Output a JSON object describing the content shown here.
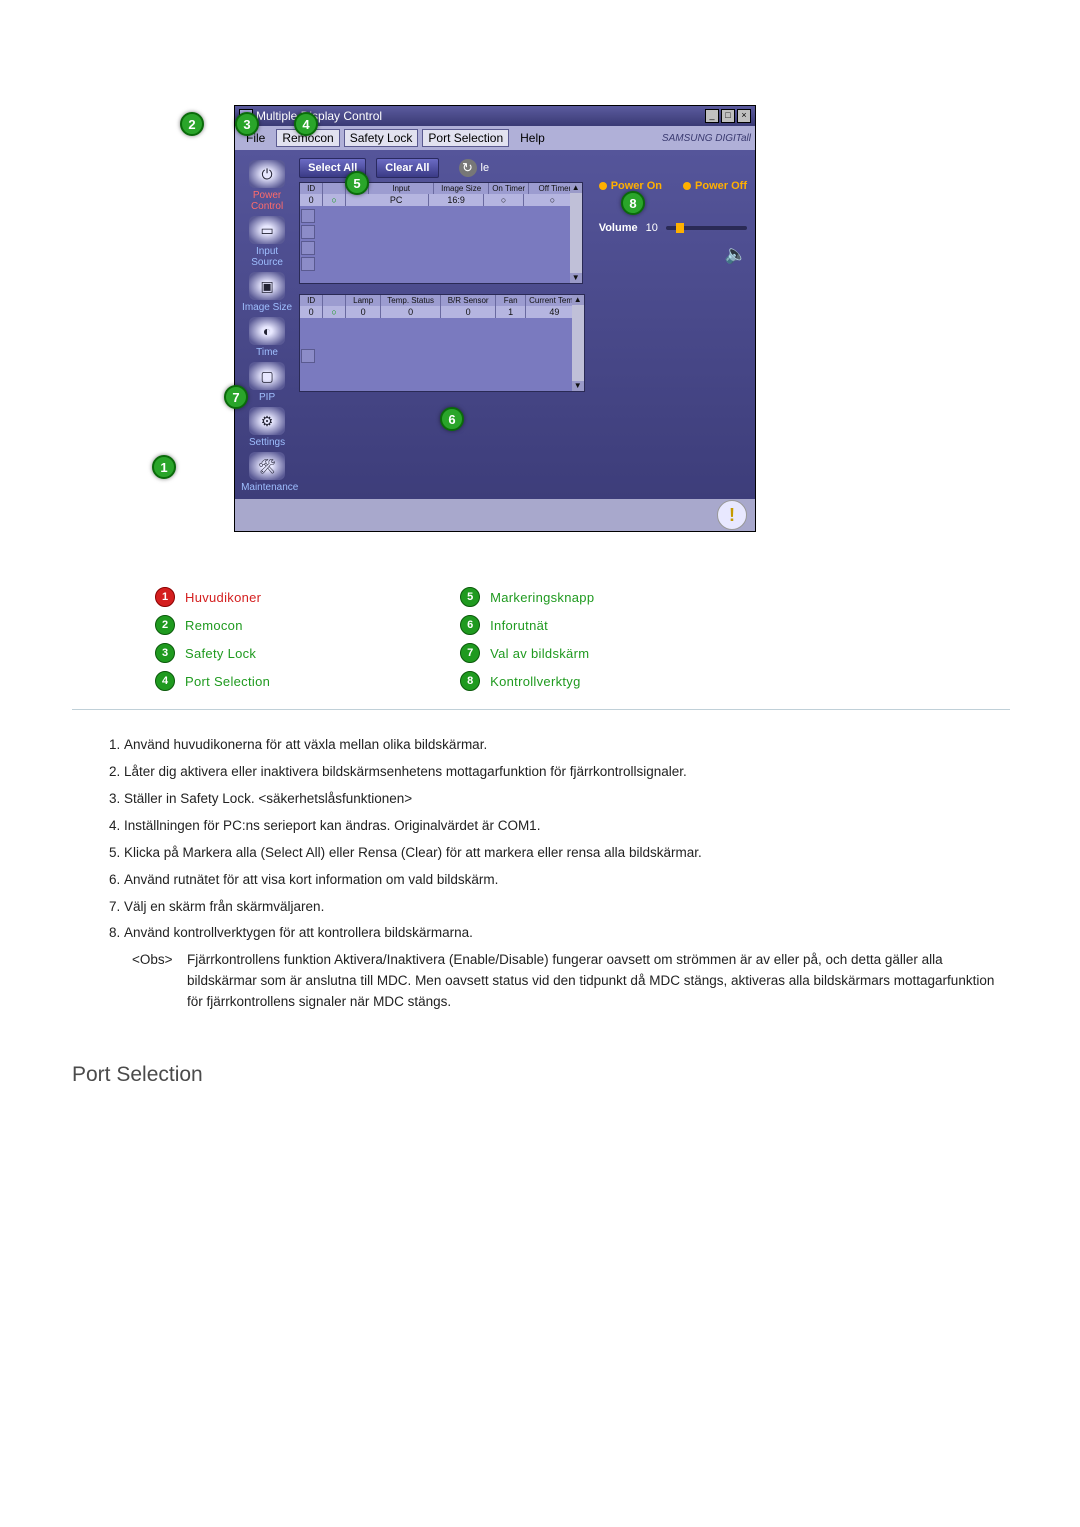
{
  "window": {
    "title": "Multiple Display Control",
    "brand": "SAMSUNG DIGITall"
  },
  "menu": {
    "file": "File",
    "remocon": "Remocon",
    "safety_lock": "Safety Lock",
    "port_selection": "Port Selection",
    "help": "Help"
  },
  "sidebar": {
    "power_control": "Power Control",
    "input_source": "Input Source",
    "image_size": "Image Size",
    "time": "Time",
    "pip": "PIP",
    "settings": "Settings",
    "maintenance": "Maintenance"
  },
  "buttons": {
    "select_all": "Select All",
    "clear_all": "Clear All",
    "cycle": "le"
  },
  "grid1": {
    "headers": [
      "ID",
      "",
      "",
      "Input",
      "Image Size",
      "On Timer",
      "Off Timer"
    ],
    "row": [
      "0",
      "○",
      "PC",
      "16:9",
      "○",
      "○"
    ]
  },
  "grid2": {
    "headers": [
      "ID",
      "",
      "Lamp",
      "Temp. Status",
      "B/R Sensor",
      "Fan",
      "Current Temp."
    ],
    "row": [
      "0",
      "○",
      "0",
      "0",
      "0",
      "1",
      "49"
    ]
  },
  "right": {
    "power_on": "Power On",
    "power_off": "Power Off",
    "volume_label": "Volume",
    "volume_value": "10"
  },
  "legend": {
    "1": "Huvudikoner",
    "2": "Remocon",
    "3": "Safety Lock",
    "4": "Port Selection",
    "5": "Markeringsknapp",
    "6": "Inforutnät",
    "7": "Val av bildskärm",
    "8": "Kontrollverktyg"
  },
  "list": {
    "i1": "Använd huvudikonerna för att växla mellan olika bildskärmar.",
    "i2": "Låter dig aktivera eller inaktivera bildskärmsenhetens mottagarfunktion för fjärrkontrollsignaler.",
    "i3": "Ställer in Safety Lock. <säkerhetslåsfunktionen>",
    "i4": "Inställningen för PC:ns serieport kan ändras. Originalvärdet är COM1.",
    "i5": "Klicka på Markera alla (Select All) eller Rensa (Clear) för att markera eller rensa alla bildskärmar.",
    "i6": "Använd rutnätet för att visa kort information om vald bildskärm.",
    "i7": "Välj en skärm från skärmväljaren.",
    "i8": "Använd kontrollverktygen för att kontrollera bildskärmarna.",
    "note_label": "<Obs>",
    "note_text": "Fjärrkontrollens funktion Aktivera/Inaktivera (Enable/Disable) fungerar oavsett om strömmen är av eller på, och detta gäller alla bildskärmar som är anslutna till MDC. Men oavsett status vid den tidpunkt då MDC stängs, aktiveras alla bildskärmars mottagarfunktion för fjärrkontrollens signaler när MDC stängs."
  },
  "heading": "Port Selection",
  "marker_numbers": [
    "1",
    "2",
    "3",
    "4",
    "5",
    "6",
    "7",
    "8"
  ],
  "colors": {
    "page_bg": "#ffffff"
  }
}
